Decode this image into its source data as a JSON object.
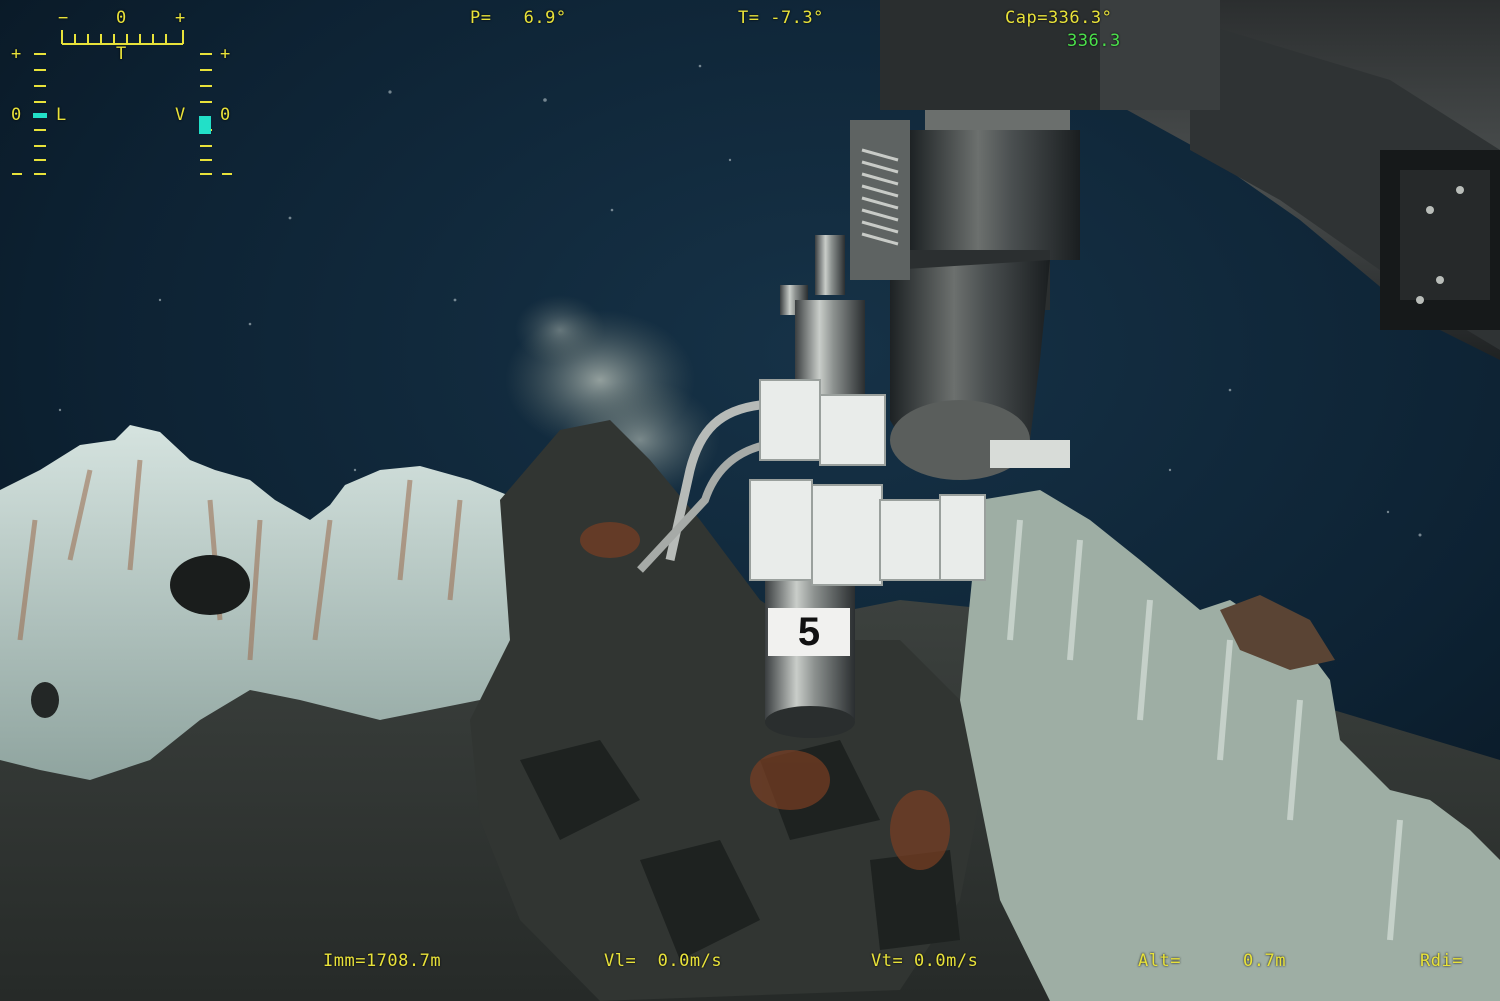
{
  "hud": {
    "tilt_scale": {
      "minus": "−",
      "zero": "0",
      "plus": "+",
      "letter": "T"
    },
    "left_scale": {
      "plus": "+",
      "zero": "0",
      "letter": "L"
    },
    "right_scale": {
      "plus": "+",
      "zero": "0",
      "letter": "V"
    },
    "pitch": "P=   6.9°",
    "temperature": "T= -7.3°",
    "heading": "Cap=336.3°",
    "heading_secondary": "336.3",
    "immersion": "Imm=1708.7m",
    "vel_longitudinal": "Vl=  0.0m/s",
    "vel_transverse": "Vt= 0.0m/s",
    "altitude_label": "Alt=",
    "altitude_value": "0.7m",
    "rdi": "Rdi="
  },
  "scene": {
    "sample_number": "5"
  },
  "colors": {
    "hud_yellow": "#e8e23a",
    "hud_green": "#4be04b",
    "hud_cyan_marker": "#22e0c8",
    "water": "#0b1c2a"
  }
}
